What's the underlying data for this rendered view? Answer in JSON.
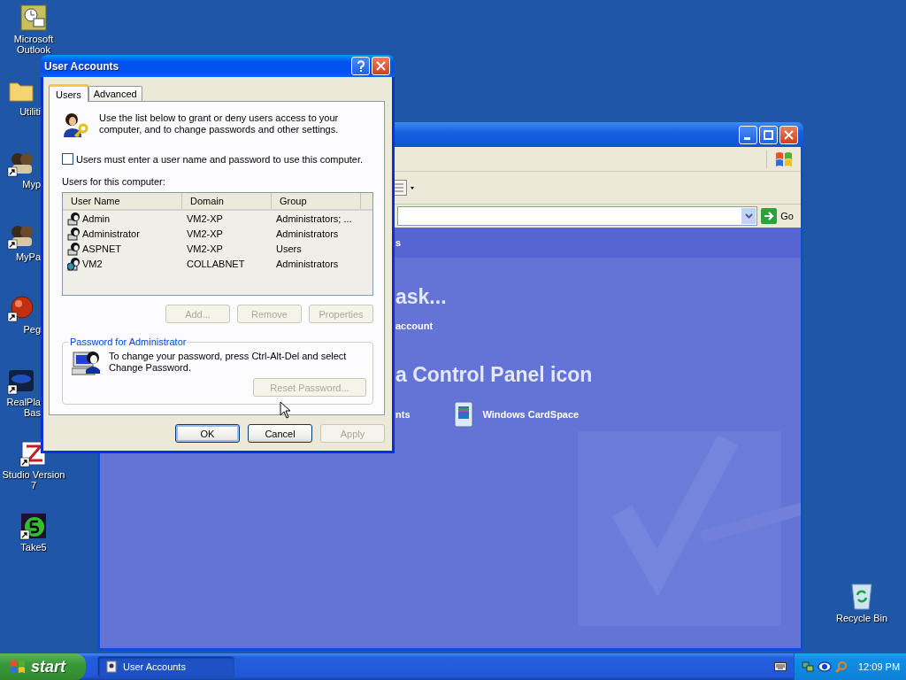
{
  "desktop_icons": [
    {
      "kind": "outlook",
      "label": "Microsoft Outlook"
    },
    {
      "kind": "folder",
      "label": "Utiliti"
    },
    {
      "kind": "people",
      "label": "Myp"
    },
    {
      "kind": "people",
      "label": "MyPa"
    },
    {
      "kind": "red-ball",
      "label": "Peg"
    },
    {
      "kind": "real",
      "label": "RealPla Bas"
    },
    {
      "kind": "studio",
      "label": "Studio Version 7"
    },
    {
      "kind": "take5",
      "label": "Take5"
    }
  ],
  "recycle_bin": {
    "label": "Recycle Bin"
  },
  "control_panel_window": {
    "go_button": "Go",
    "section_header": "s",
    "task_heading": "ask...",
    "task_link": "account",
    "icon_heading": "a Control Panel icon",
    "icons": [
      {
        "kind": "partial",
        "label": "nts"
      },
      {
        "kind": "cardspace",
        "label": "Windows CardSpace"
      }
    ]
  },
  "dialog": {
    "title": "User Accounts",
    "tabs": [
      {
        "label": "Users",
        "selected": true
      },
      {
        "label": "Advanced",
        "selected": false
      }
    ],
    "intro": "Use the list below to grant or deny users access to your computer, and to change passwords and other settings.",
    "checkbox": {
      "label": "Users must enter a user name and password to use this computer.",
      "checked": false
    },
    "list_label": "Users for this computer:",
    "columns": [
      "User Name",
      "Domain",
      "Group"
    ],
    "rows": [
      {
        "kind": "user",
        "user_name": "Admin",
        "domain": "VM2-XP",
        "group": "Administrators; ..."
      },
      {
        "kind": "user",
        "user_name": "Administrator",
        "domain": "VM2-XP",
        "group": "Administrators"
      },
      {
        "kind": "user",
        "user_name": "ASPNET",
        "domain": "VM2-XP",
        "group": "Users"
      },
      {
        "kind": "domain-user",
        "user_name": "VM2",
        "domain": "COLLABNET",
        "group": "Administrators"
      }
    ],
    "list_buttons": [
      {
        "label": "Add...",
        "disabled": true
      },
      {
        "label": "Remove",
        "disabled": true
      },
      {
        "label": "Properties",
        "disabled": true
      }
    ],
    "password_group": {
      "title": "Password for Administrator",
      "text": "To change your password, press Ctrl-Alt-Del and select Change Password.",
      "button": {
        "label": "Reset Password...",
        "disabled": true
      }
    },
    "footer_buttons": [
      {
        "label": "OK",
        "disabled": false
      },
      {
        "label": "Cancel",
        "disabled": false
      },
      {
        "label": "Apply",
        "disabled": true
      }
    ]
  },
  "taskbar": {
    "start": "start",
    "tasks": [
      {
        "label": "User Accounts",
        "selected": true
      }
    ],
    "clock": "12:09 PM"
  }
}
